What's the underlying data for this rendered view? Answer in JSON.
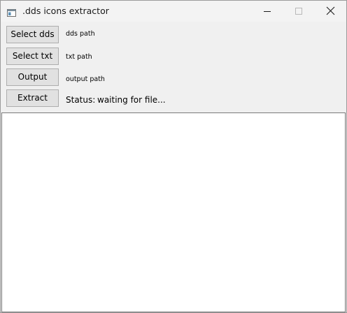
{
  "window": {
    "title": ".dds icons extractor",
    "icon": "app-window-icon",
    "controls": {
      "minimize_icon": "minimize-icon",
      "maximize_icon": "maximize-icon",
      "close_icon": "close-icon"
    }
  },
  "buttons": {
    "select_dds": "Select dds",
    "select_txt": "Select txt",
    "output": "Output",
    "extract": "Extract"
  },
  "labels": {
    "dds_path": "dds path",
    "txt_path": "txt path",
    "output_path": "output path"
  },
  "status": {
    "caption": "Status:",
    "value": "waiting for file..."
  },
  "log": {
    "text": ""
  },
  "colors": {
    "titlebar": "#f3f3f3",
    "client": "#f0f0f0",
    "button_face": "#e1e1e1",
    "button_border": "#adadad"
  }
}
